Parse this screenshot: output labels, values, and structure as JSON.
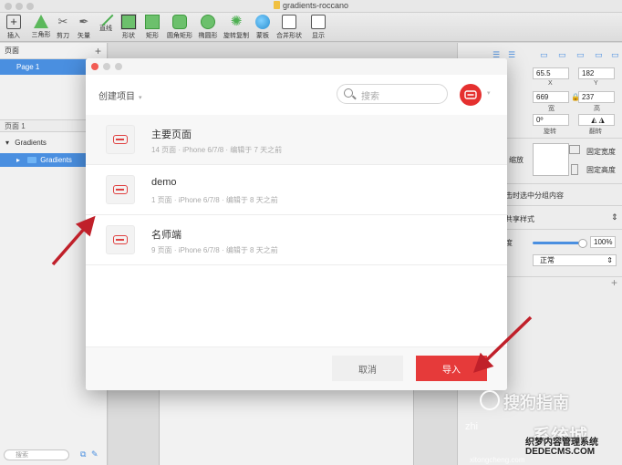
{
  "window": {
    "title": "gradients-roccano"
  },
  "toolbar": {
    "items": [
      {
        "label": "插入",
        "icon": "plus-icon"
      },
      {
        "label": "三角形",
        "icon": "triangle-icon"
      },
      {
        "label": "剪刀",
        "icon": "scissors-icon"
      },
      {
        "label": "矢量",
        "icon": "vector-icon"
      },
      {
        "label": "直线",
        "icon": "line-icon"
      },
      {
        "label": "形状",
        "icon": "shape-icon"
      },
      {
        "label": "矩形",
        "icon": "rectangle-icon"
      },
      {
        "label": "圆角矩形",
        "icon": "rounded-rectangle-icon"
      },
      {
        "label": "椭圆形",
        "icon": "oval-icon"
      },
      {
        "label": "旋转复制",
        "icon": "rotate-copy-icon"
      },
      {
        "label": "蒙板",
        "icon": "mask-icon"
      },
      {
        "label": "合并形状",
        "icon": "combine-icon"
      },
      {
        "label": "显示",
        "icon": "view-icon"
      }
    ]
  },
  "left_panel": {
    "pages_header": "页面",
    "pages": [
      "Page 1"
    ],
    "layers_header": "页面 1",
    "layers": [
      {
        "name": "Gradients",
        "indent": 0,
        "selected": false
      },
      {
        "name": "Gradients",
        "indent": 1,
        "selected": true
      }
    ],
    "search_placeholder": "搜索"
  },
  "right_panel": {
    "x": "65.5",
    "y": "182",
    "x_label": "X",
    "y_label": "Y",
    "width": "669",
    "height": "237",
    "width_label": "宽",
    "height_label": "高",
    "rotation": "0º",
    "rotation_label": "旋转",
    "flip_label": "翻转",
    "resize_label": "缩放",
    "fixed_width": "固定宽度",
    "fixed_height": "固定高度",
    "select_group_text": "击时选中分组内容",
    "shared_style": "共享样式",
    "opacity_label": "度",
    "opacity_value": "100%",
    "blend_mode": "正常"
  },
  "dialog": {
    "create_label": "创建项目",
    "search_placeholder": "搜索",
    "projects": [
      {
        "name": "主要页面",
        "pages": "14 页面",
        "device": "iPhone 6/7/8",
        "edited": "编辑于 7 天之前"
      },
      {
        "name": "demo",
        "pages": "1 页面",
        "device": "iPhone 6/7/8",
        "edited": "编辑于 8 天之前"
      },
      {
        "name": "名师端",
        "pages": "9 页面",
        "device": "iPhone 6/7/8",
        "edited": "编辑于 8 天之前"
      }
    ],
    "cancel_label": "取消",
    "import_label": "导入"
  },
  "watermark": {
    "line1": "搜狗指南",
    "line2": "系统城",
    "line3": "织梦内容管理系统",
    "line4": "DEDECMS.COM",
    "line5": "zhi",
    "line6": "xitongcheng.com"
  },
  "colors": {
    "accent_blue": "#4a8fe0",
    "import_red": "#e63a3a",
    "avatar_red": "#e5302f"
  }
}
